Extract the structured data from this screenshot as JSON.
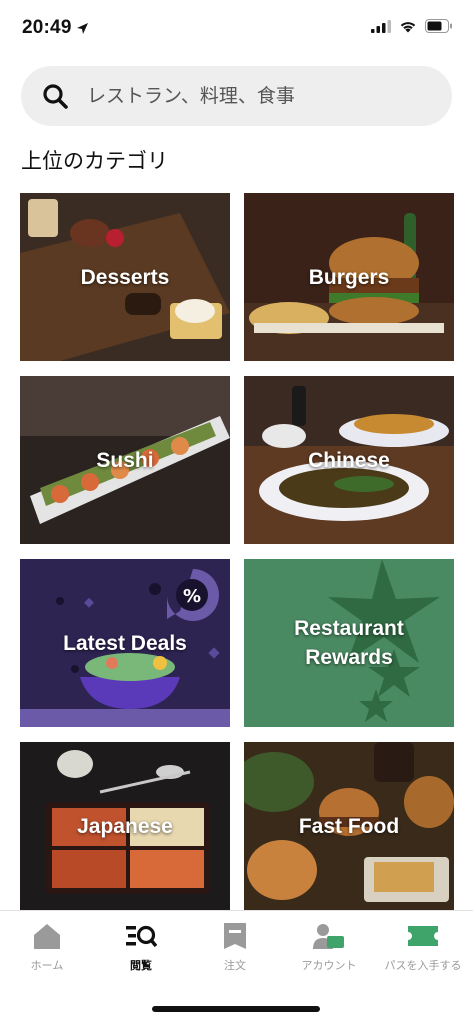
{
  "status_bar": {
    "time": "20:49"
  },
  "search": {
    "placeholder": "レストラン、料理、食事"
  },
  "section": {
    "title": "上位のカテゴリ"
  },
  "categories": [
    {
      "label": "Desserts"
    },
    {
      "label": "Burgers"
    },
    {
      "label": "Sushi"
    },
    {
      "label": "Chinese"
    },
    {
      "label": "Latest Deals"
    },
    {
      "label": "Restaurant\nRewards"
    },
    {
      "label": "Japanese"
    },
    {
      "label": "Fast Food"
    }
  ],
  "bottom_nav": {
    "items": [
      {
        "label": "ホーム",
        "icon": "home-icon"
      },
      {
        "label": "閲覧",
        "icon": "browse-icon"
      },
      {
        "label": "注文",
        "icon": "receipt-icon"
      },
      {
        "label": "アカウント",
        "icon": "account-icon"
      },
      {
        "label": "パスを入手する",
        "icon": "pass-ticket-icon"
      }
    ],
    "active_index": 1
  },
  "colors": {
    "accent_green": "#3fa46a",
    "deals_purple": "#3a2a64",
    "rewards_green": "#4a8a62"
  }
}
